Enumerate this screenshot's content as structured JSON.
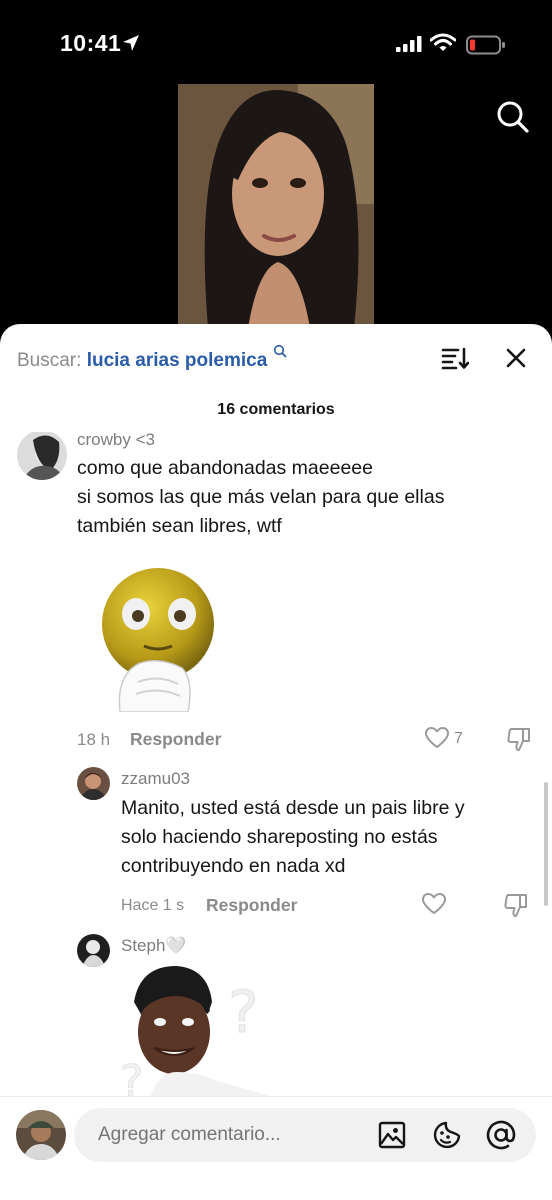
{
  "status_bar": {
    "time": "10:41"
  },
  "sheet": {
    "search_prefix": "Buscar:",
    "search_query": "lucia arias polemica",
    "comment_count": "16 comentarios"
  },
  "comments": [
    {
      "username": "crowby <3",
      "text": [
        "como que abandonadas maeeeee",
        "si somos las que más velan para que ellas",
        "también sean libres, wtf"
      ],
      "sticker": "surprised-emoji-sticker",
      "time": "18 h",
      "reply_label": "Responder",
      "likes": "7"
    },
    {
      "username": "zzamu03",
      "text": [
        "Manito, usted está desde un pais libre y",
        "solo haciendo shareposting no estás",
        "contribuyendo en nada xd"
      ],
      "time": "Hace 1 s",
      "reply_label": "Responder"
    },
    {
      "username": "Steph🤍",
      "sticker": "confused-man-meme"
    }
  ],
  "composer": {
    "placeholder": "Agregar comentario..."
  },
  "colors": {
    "accent": "#2b5ca8",
    "muted": "#8a8a8a",
    "text": "#161616",
    "sheet": "#ffffff",
    "background": "#000000"
  }
}
